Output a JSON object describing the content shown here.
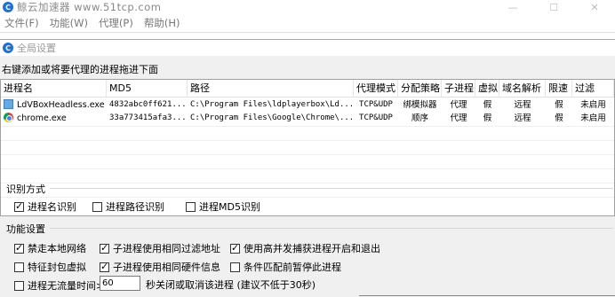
{
  "app": {
    "title": "鲸云加速器 www.51tcp.com",
    "logo_letter": "C",
    "controls": [
      "—",
      "☐",
      "✕"
    ]
  },
  "menu": [
    "文件(F)",
    "功能(W)",
    "代理(P)",
    "帮助(H)"
  ],
  "dialog": {
    "title": "全局设置",
    "hint": "右键添加或将要代理的进程拖进下面",
    "table": {
      "columns": [
        "进程名",
        "MD5",
        "路径",
        "代理模式",
        "分配策略",
        "子进程",
        "虚拟",
        "域名解析",
        "限速",
        "过滤"
      ],
      "rows": [
        {
          "icon": "ldplayer-icon",
          "name": "LdVBoxHeadless.exe",
          "md5": "4832abc0ff621...",
          "path": "C:\\Program Files\\ldplayerbox\\Ld...",
          "mode": "TCP&UDP",
          "strategy": "绑模拟器",
          "child": "代理",
          "virtual": "假",
          "dns": "远程",
          "limit": "假",
          "filter": "未启用"
        },
        {
          "icon": "chrome-icon",
          "name": "chrome.exe",
          "md5": "33a773415afa3...",
          "path": "C:\\Program Files\\Google\\Chrome\\...",
          "mode": "TCP&UDP",
          "strategy": "顺序",
          "child": "代理",
          "virtual": "假",
          "dns": "远程",
          "limit": "假",
          "filter": "未启用"
        }
      ]
    },
    "identify": {
      "label": "识别方式",
      "options": [
        {
          "label": "进程名识别",
          "checked": true
        },
        {
          "label": "进程路径识别",
          "checked": false
        },
        {
          "label": "进程MD5识别",
          "checked": false
        }
      ]
    },
    "features": {
      "label": "功能设置",
      "options": [
        {
          "label": "禁走本地网络",
          "checked": true
        },
        {
          "label": "子进程使用相同过滤地址",
          "checked": true
        },
        {
          "label": "使用高并发捕获进程开启和退出",
          "checked": true
        },
        {
          "label": "特征封包虚拟",
          "checked": false
        },
        {
          "label": "子进程使用相同硬件信息",
          "checked": true
        },
        {
          "label": "条件匹配前暂停此进程",
          "checked": false
        }
      ],
      "timeout_label": "进程无流量时间>",
      "timeout_checked": false,
      "timeout_value": "60",
      "timeout_hint": "秒关闭或取消该进程 (建议不低于30秒)"
    }
  }
}
